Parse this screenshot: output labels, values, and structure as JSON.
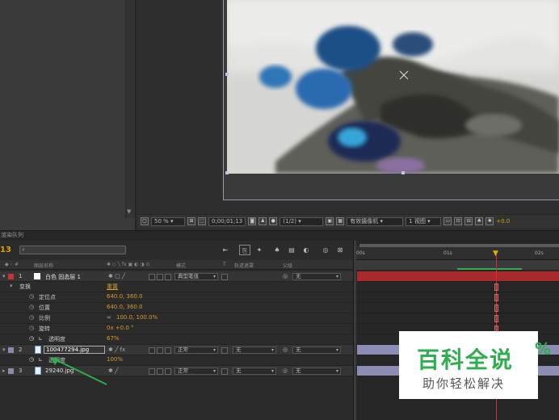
{
  "viewer": {
    "zoom": "50 %",
    "time": "0;00;01;13",
    "resolution": "(1/2)",
    "camera": "有效摄像机",
    "views": "1 视图",
    "exposure": "+0.0"
  },
  "timeline": {
    "tab_label": "渲染队列",
    "timecode": "13",
    "search_placeholder": "",
    "columns": {
      "layer_name": "图层名称",
      "mode": "模式",
      "t": "T",
      "trkmat": "轨道遮罩",
      "parent": "父级"
    },
    "ruler": {
      "start": "00s",
      "mark1": "01s",
      "mark2": "02s"
    },
    "layers": [
      {
        "num": "1",
        "name": "白色 固态层 1",
        "mode": "典型笔值",
        "parent": "无",
        "color": "#c83232"
      },
      {
        "num": "2",
        "name": "100477294.jpg",
        "mode": "正常",
        "trkmat": "无",
        "parent": "无",
        "color": "#8a8ab0"
      },
      {
        "num": "3",
        "name": "29240.jpg",
        "mode": "正常",
        "trkmat": "无",
        "parent": "无",
        "color": "#8a8ab0"
      }
    ],
    "transform": {
      "label": "变换",
      "reset": "重置",
      "props": [
        {
          "name": "定位点",
          "value": "640.0, 360.0"
        },
        {
          "name": "位置",
          "value": "640.0, 360.0"
        },
        {
          "name": "比例",
          "value": "100.0, 100.0%"
        },
        {
          "name": "旋转",
          "value": "0x +0.0 °"
        },
        {
          "name": "透明度",
          "value": "67%"
        }
      ]
    },
    "layer2_opacity": {
      "name": "透明度",
      "value": "100%"
    }
  },
  "watermark": {
    "title": "百科全说",
    "subtitle": "助你轻松解决",
    "percent_glyph": "%"
  }
}
